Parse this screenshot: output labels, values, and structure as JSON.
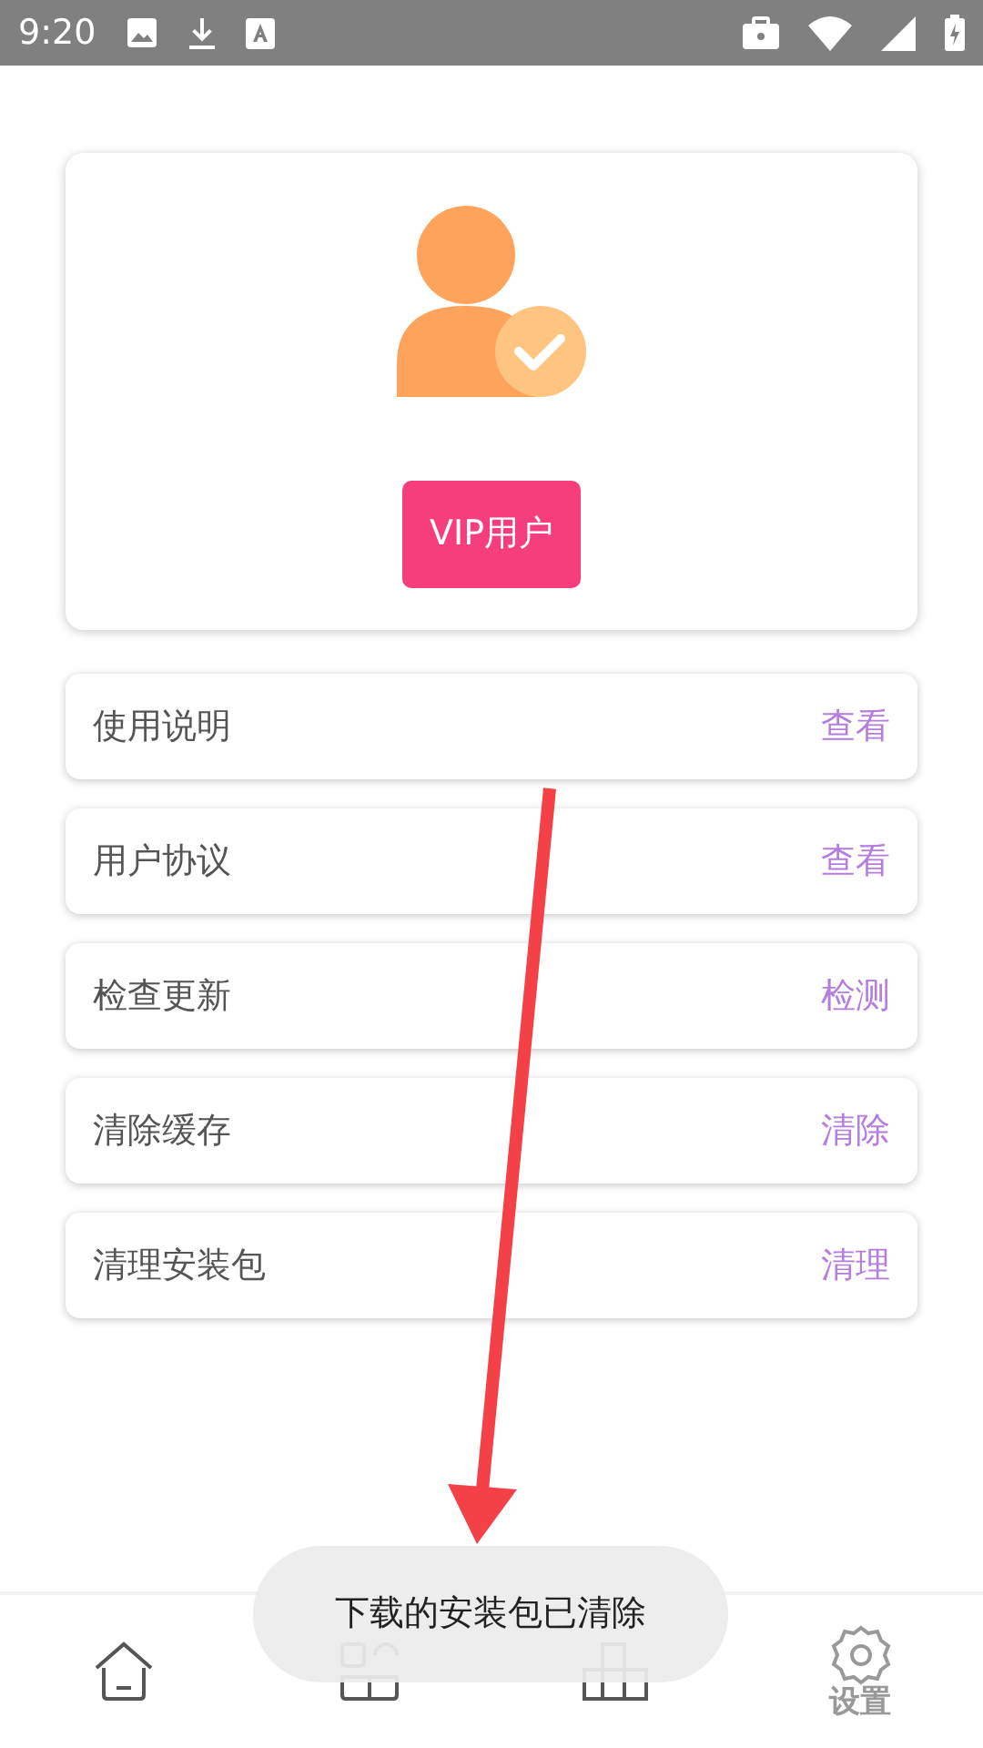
{
  "status_bar": {
    "time": "9:20"
  },
  "profile": {
    "badge": "VIP用户"
  },
  "menu": [
    {
      "label": "使用说明",
      "action": "查看"
    },
    {
      "label": "用户协议",
      "action": "查看"
    },
    {
      "label": "检查更新",
      "action": "检测"
    },
    {
      "label": "清除缓存",
      "action": "清除"
    },
    {
      "label": "清理安装包",
      "action": "清理"
    }
  ],
  "tabs": [
    {
      "kind": "home",
      "selected": false
    },
    {
      "kind": "apps",
      "selected": false
    },
    {
      "kind": "chart",
      "selected": false
    },
    {
      "kind": "settings",
      "label": "设置",
      "selected": true
    }
  ],
  "toast": "下载的安装包已清除"
}
